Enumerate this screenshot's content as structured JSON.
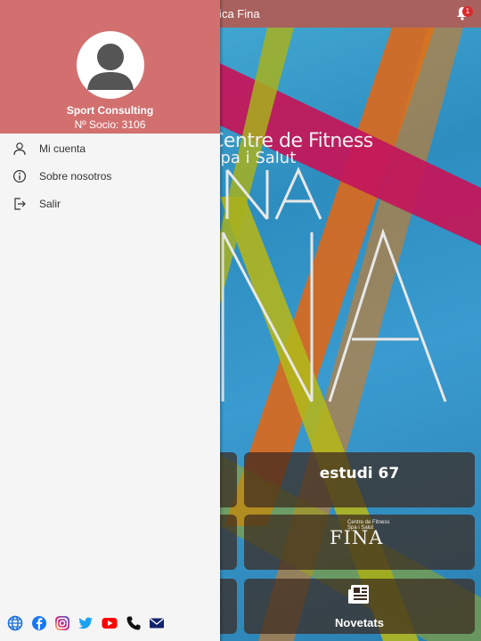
{
  "app": {
    "title": "Física Fina",
    "notification_count": "1"
  },
  "hero": {
    "line1": "Centre de Fitness",
    "line2": "Spa i Salut",
    "logo_text": "FINA"
  },
  "tiles": {
    "estudi_label": "estudi 67",
    "fina_logo_small_1": "Centre de Fitness",
    "fina_logo_small_2": "Spa i Salut",
    "fina_logo_big": "FINA",
    "news_label": "Novetats"
  },
  "drawer": {
    "user_name": "Sport Consulting",
    "member_id": "Nº Socio: 3106",
    "menu": [
      {
        "label": "Mi cuenta",
        "icon": "user-icon"
      },
      {
        "label": "Sobre nosotros",
        "icon": "info-icon"
      },
      {
        "label": "Salir",
        "icon": "logout-icon"
      }
    ],
    "social_icons": [
      "globe-icon",
      "facebook-icon",
      "instagram-icon",
      "twitter-icon",
      "youtube-icon",
      "phone-icon",
      "mail-icon"
    ]
  },
  "colors": {
    "drawer_header": "#d27070",
    "topbar": "#a9615e",
    "badge": "#d9292e"
  }
}
